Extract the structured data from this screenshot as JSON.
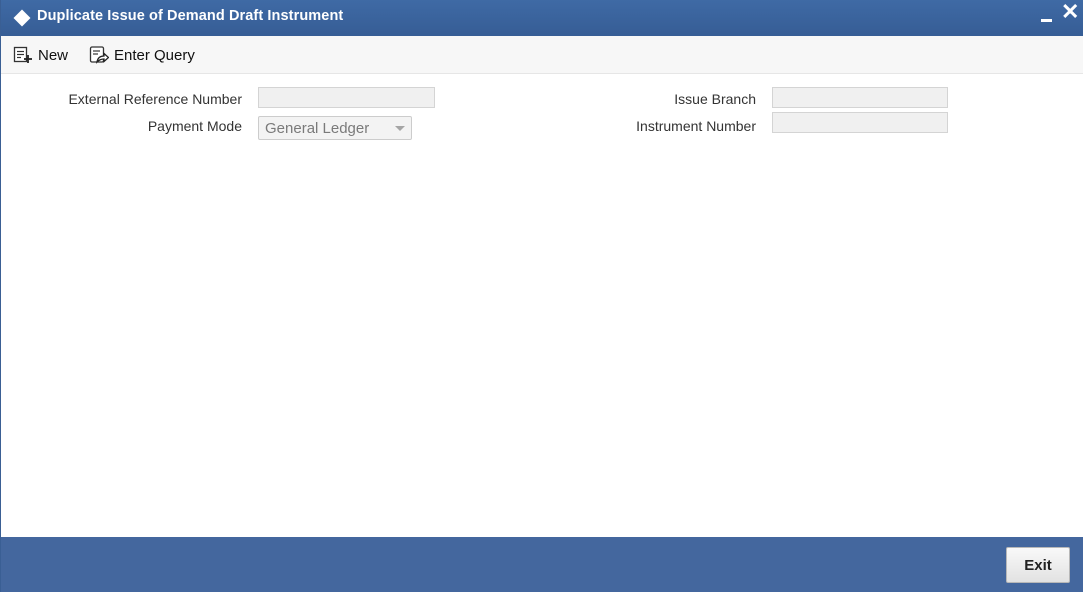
{
  "window": {
    "title": "Duplicate Issue of Demand Draft Instrument",
    "titlebar_color": "#3f6aa5",
    "footer_color": "#44679e"
  },
  "toolbar": {
    "new_label": "New",
    "new_icon": "new-record-icon",
    "enter_query_label": "Enter Query",
    "enter_query_icon": "enter-query-icon"
  },
  "form": {
    "external_reference_number": {
      "label": "External Reference Number",
      "value": ""
    },
    "payment_mode": {
      "label": "Payment Mode",
      "value": "General Ledger"
    },
    "issue_branch": {
      "label": "Issue Branch",
      "value": ""
    },
    "instrument_number": {
      "label": "Instrument Number",
      "value": ""
    }
  },
  "footer": {
    "exit_label": "Exit"
  }
}
